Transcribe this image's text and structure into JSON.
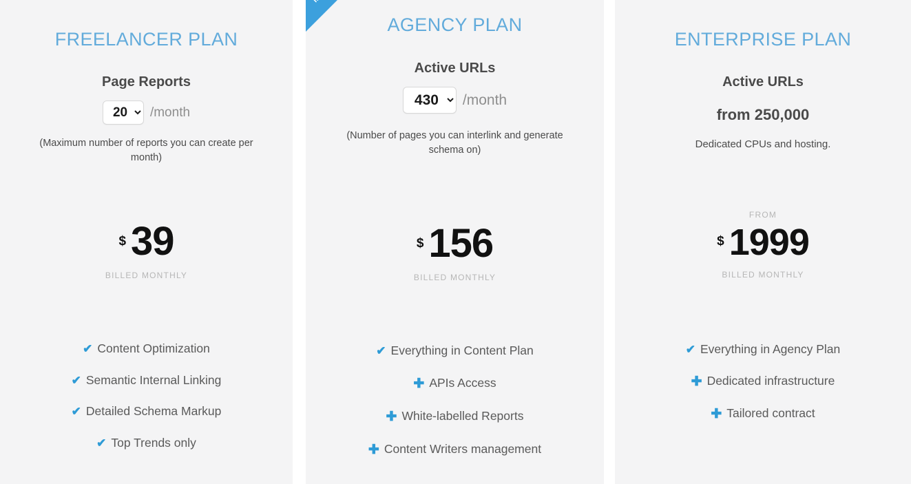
{
  "plans": [
    {
      "title": "FREELANCER PLAN",
      "ribbon": null,
      "metric_label": "Page Reports",
      "metric_type": "select",
      "metric_value": "20",
      "metric_options": [
        "20"
      ],
      "per_month": "/month",
      "metric_note": "(Maximum number of reports you can create per month)",
      "price_from": null,
      "price_currency": "$",
      "price_amount": "39",
      "price_period": "BILLED MONTHLY",
      "features": [
        {
          "icon": "check-icon",
          "glyph": "✔",
          "label": "Content Optimization"
        },
        {
          "icon": "check-icon",
          "glyph": "✔",
          "label": "Semantic Internal Linking"
        },
        {
          "icon": "check-icon",
          "glyph": "✔",
          "label": "Detailed Schema Markup"
        },
        {
          "icon": "check-icon",
          "glyph": "✔",
          "label": "Top Trends only"
        }
      ]
    },
    {
      "title": "AGENCY PLAN",
      "ribbon": "MOST POPULAR",
      "metric_label": "Active URLs",
      "metric_type": "select",
      "metric_value": "430",
      "metric_options": [
        "430"
      ],
      "per_month": "/month",
      "metric_note": "(Number of pages you can interlink and generate schema on)",
      "price_from": null,
      "price_currency": "$",
      "price_amount": "156",
      "price_period": "BILLED MONTHLY",
      "features": [
        {
          "icon": "check-icon",
          "glyph": "✔",
          "label": "Everything in Content Plan"
        },
        {
          "icon": "plus-icon",
          "glyph": "✚",
          "label": "APIs Access"
        },
        {
          "icon": "plus-icon",
          "glyph": "✚",
          "label": "White-labelled Reports"
        },
        {
          "icon": "plus-icon",
          "glyph": "✚",
          "label": "Content Writers management"
        }
      ]
    },
    {
      "title": "ENTERPRISE PLAN",
      "ribbon": null,
      "metric_label": "Active URLs",
      "metric_type": "static",
      "metric_value": "from 250,000",
      "metric_options": [],
      "per_month": null,
      "metric_note": "Dedicated CPUs and hosting.",
      "price_from": "FROM",
      "price_currency": "$",
      "price_amount": "1999",
      "price_period": "BILLED MONTHLY",
      "features": [
        {
          "icon": "check-icon",
          "glyph": "✔",
          "label": "Everything in Agency Plan"
        },
        {
          "icon": "plus-icon",
          "glyph": "✚",
          "label": "Dedicated infrastructure"
        },
        {
          "icon": "plus-icon",
          "glyph": "✚",
          "label": "Tailored contract"
        }
      ]
    }
  ],
  "colors": {
    "title_blue": "#62abdb",
    "icon_blue": "#2e9bd6",
    "ribbon_blue": "#3ca0dd",
    "card_background": "#f4f4f5",
    "price_text": "#111111",
    "muted_text": "#b6b6b6"
  }
}
